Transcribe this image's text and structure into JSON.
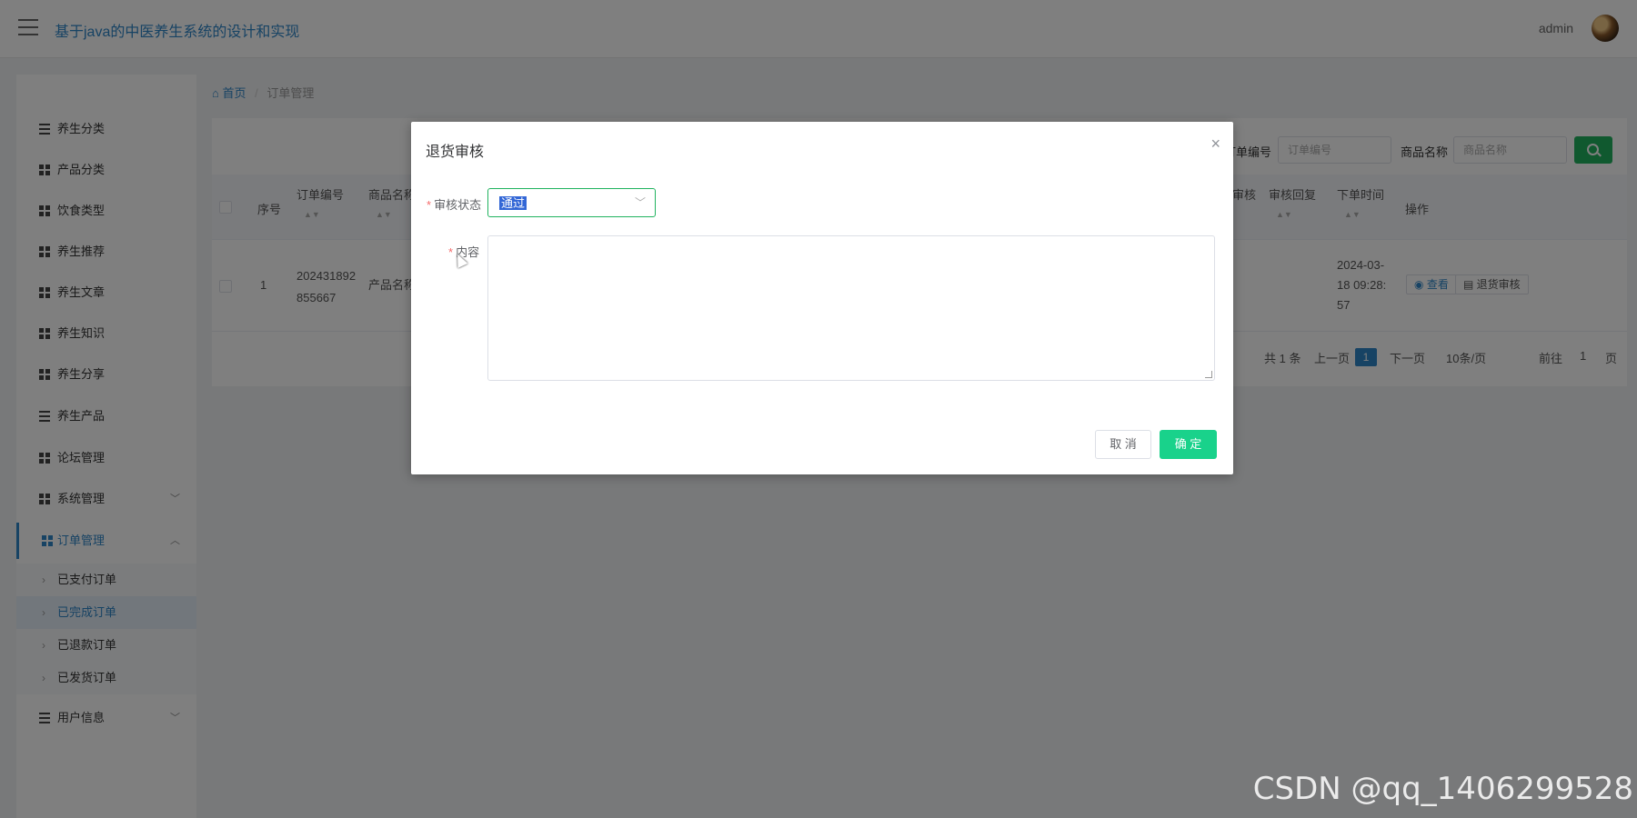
{
  "header": {
    "title": "基于java的中医养生系统的设计和实现",
    "user": "admin"
  },
  "sidebar": {
    "items": [
      {
        "label": "养生分类",
        "icon": "list-icon"
      },
      {
        "label": "产品分类",
        "icon": "grid-icon"
      },
      {
        "label": "饮食类型",
        "icon": "grid-icon"
      },
      {
        "label": "养生推荐",
        "icon": "grid-icon"
      },
      {
        "label": "养生文章",
        "icon": "book-icon"
      },
      {
        "label": "养生知识",
        "icon": "bus-icon"
      },
      {
        "label": "养生分享",
        "icon": "grid-icon"
      },
      {
        "label": "养生产品",
        "icon": "sliders-icon"
      },
      {
        "label": "论坛管理",
        "icon": "grid-icon"
      },
      {
        "label": "系统管理",
        "icon": "user-icon"
      },
      {
        "label": "订单管理",
        "icon": "grid-icon"
      },
      {
        "label": "用户信息",
        "icon": "card-icon"
      }
    ],
    "sub_items": [
      {
        "label": "已支付订单"
      },
      {
        "label": "已完成订单"
      },
      {
        "label": "已退款订单"
      },
      {
        "label": "已发货订单"
      }
    ]
  },
  "breadcrumb": {
    "home": "首页",
    "separator": "/",
    "current": "订单管理"
  },
  "search": {
    "order_no_label": "订单编号",
    "order_no_placeholder": "订单编号",
    "product_label": "商品名称",
    "product_placeholder": "商品名称"
  },
  "table": {
    "headers": {
      "index": "序号",
      "order_no": "订单编号",
      "product": "商品名称",
      "review": "审核",
      "review_reply": "审核回复",
      "order_time": "下单时间",
      "actions": "操作"
    },
    "rows": [
      {
        "index": "1",
        "order_no_1": "202431892",
        "order_no_2": "855667",
        "product": "产品名称",
        "time_1": "2024-03-",
        "time_2": "18 09:28:",
        "time_3": "57",
        "view": "查看",
        "return_review": "退货审核"
      }
    ]
  },
  "pagination": {
    "total": "共 1 条",
    "prev": "上一页",
    "current": "1",
    "next": "下一页",
    "page_size": "10条/页",
    "goto": "前往",
    "goto_value": "1",
    "page_suffix": "页"
  },
  "dialog": {
    "title": "退货审核",
    "close": "×",
    "status_label": "审核状态",
    "status_value": "通过",
    "content_label": "内容",
    "content_value": "",
    "cancel": "取 消",
    "confirm": "确 定"
  },
  "watermark": "CSDN @qq_1406299528",
  "colors": {
    "primary": "#2f86c8",
    "success": "#19d28b",
    "search_button": "#20b35f"
  }
}
